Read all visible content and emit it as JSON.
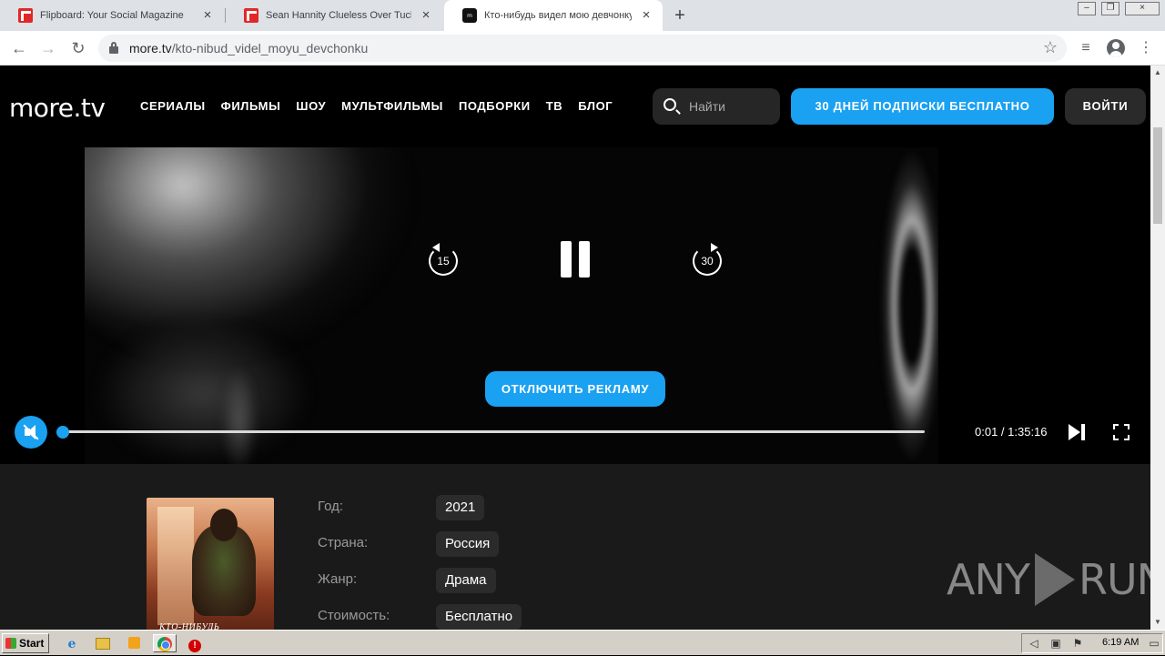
{
  "browser": {
    "tabs": [
      {
        "title": "Flipboard: Your Social Magazine"
      },
      {
        "title": "Sean Hannity Clueless Over Tucker C"
      },
      {
        "title": "Кто-нибудь видел мою девчонку?"
      }
    ],
    "url_host": "more.tv",
    "url_path": "/kto-nibud_videl_moyu_devchonku"
  },
  "site": {
    "logo": "more.tv",
    "nav": [
      "СЕРИАЛЫ",
      "ФИЛЬМЫ",
      "ШОУ",
      "МУЛЬТФИЛЬМЫ",
      "ПОДБОРКИ",
      "ТВ",
      "БЛОГ"
    ],
    "search_placeholder": "Найти",
    "trial_button": "30 ДНЕЙ ПОДПИСКИ БЕСПЛАТНО",
    "login_button": "ВОЙТИ",
    "accent_color": "#1aa1f1"
  },
  "player": {
    "rewind_seconds": "15",
    "forward_seconds": "30",
    "disable_ads_button": "ОТКЛЮЧИТЬ РЕКЛАМУ",
    "time": "0:01 / 1:35:16",
    "progress_fraction": 0.0002,
    "muted": true,
    "state": "playing"
  },
  "details": {
    "poster_title": "КТО-НИБУДЬ",
    "meta": [
      {
        "label": "Год:",
        "value": "2021"
      },
      {
        "label": "Страна:",
        "value": "Россия"
      },
      {
        "label": "Жанр:",
        "value": "Драма"
      },
      {
        "label": "Стоимость:",
        "value": "Бесплатно"
      }
    ]
  },
  "watermark": {
    "left": "ANY",
    "right": "RUN"
  },
  "taskbar": {
    "start_label": "Start",
    "clock": "6:19 AM"
  }
}
